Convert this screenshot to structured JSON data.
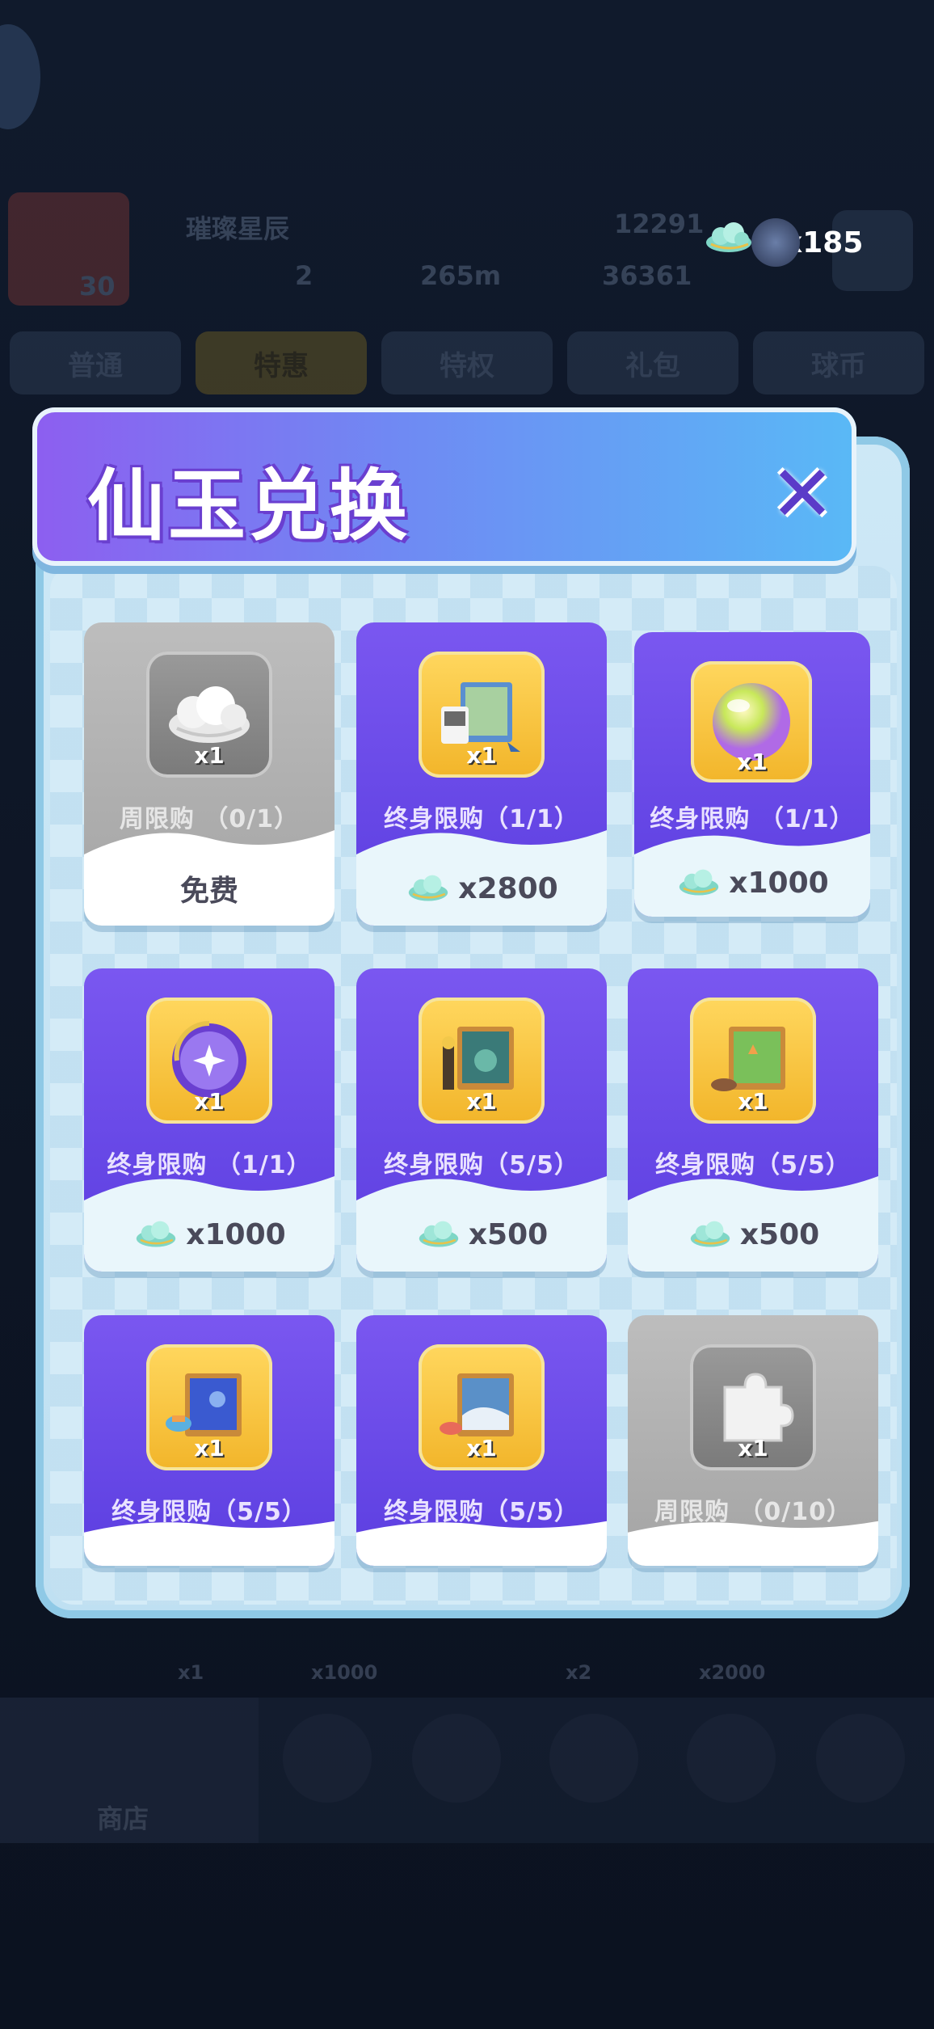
{
  "currency": {
    "amount": "x185",
    "icon": "cloud-icon"
  },
  "background": {
    "player_name": "璀璨星辰",
    "level": "30",
    "score": "12291",
    "stat_a": "2",
    "distance": "265m",
    "gems": "36361",
    "tabs": [
      "普通",
      "特惠",
      "特权",
      "礼包",
      "球币"
    ],
    "shop_label": "商店",
    "bottom_values": [
      "x1",
      "x1000",
      "x2",
      "x2000"
    ]
  },
  "modal": {
    "title": "仙玉兑换",
    "close_icon": "close-icon"
  },
  "items": [
    {
      "icon": "cloud-icon",
      "qty": "x1",
      "limit": "周限购 （0/1）",
      "price": "免费",
      "price_icon": false,
      "style": "grey"
    },
    {
      "icon": "photo-frame-icon",
      "qty": "x1",
      "limit": "终身限购（1/1）",
      "price": "x2800",
      "price_icon": true,
      "style": "purple"
    },
    {
      "icon": "bubble-orb-icon",
      "qty": "x1",
      "limit": "终身限购 （1/1）",
      "price": "x1000",
      "price_icon": true,
      "style": "purple"
    },
    {
      "icon": "star-orb-icon",
      "qty": "x1",
      "limit": "终身限购 （1/1）",
      "price": "x1000",
      "price_icon": true,
      "style": "purple"
    },
    {
      "icon": "photo-frame-icon",
      "qty": "x1",
      "limit": "终身限购（5/5）",
      "price": "x500",
      "price_icon": true,
      "style": "purple"
    },
    {
      "icon": "photo-frame-icon",
      "qty": "x1",
      "limit": "终身限购（5/5）",
      "price": "x500",
      "price_icon": true,
      "style": "purple"
    },
    {
      "icon": "photo-frame-icon",
      "qty": "x1",
      "limit": "终身限购（5/5）",
      "price": "",
      "price_icon": false,
      "style": "purple"
    },
    {
      "icon": "photo-frame-icon",
      "qty": "x1",
      "limit": "终身限购（5/5）",
      "price": "",
      "price_icon": false,
      "style": "purple"
    },
    {
      "icon": "puzzle-piece-icon",
      "qty": "x1",
      "limit": "周限购 （0/10）",
      "price": "",
      "price_icon": false,
      "style": "grey"
    }
  ],
  "colors": {
    "accent_purple": "#6a48ea",
    "title_purple": "#6a3fd0",
    "panel": "#cde8f6",
    "gold": "#f2b52a"
  }
}
